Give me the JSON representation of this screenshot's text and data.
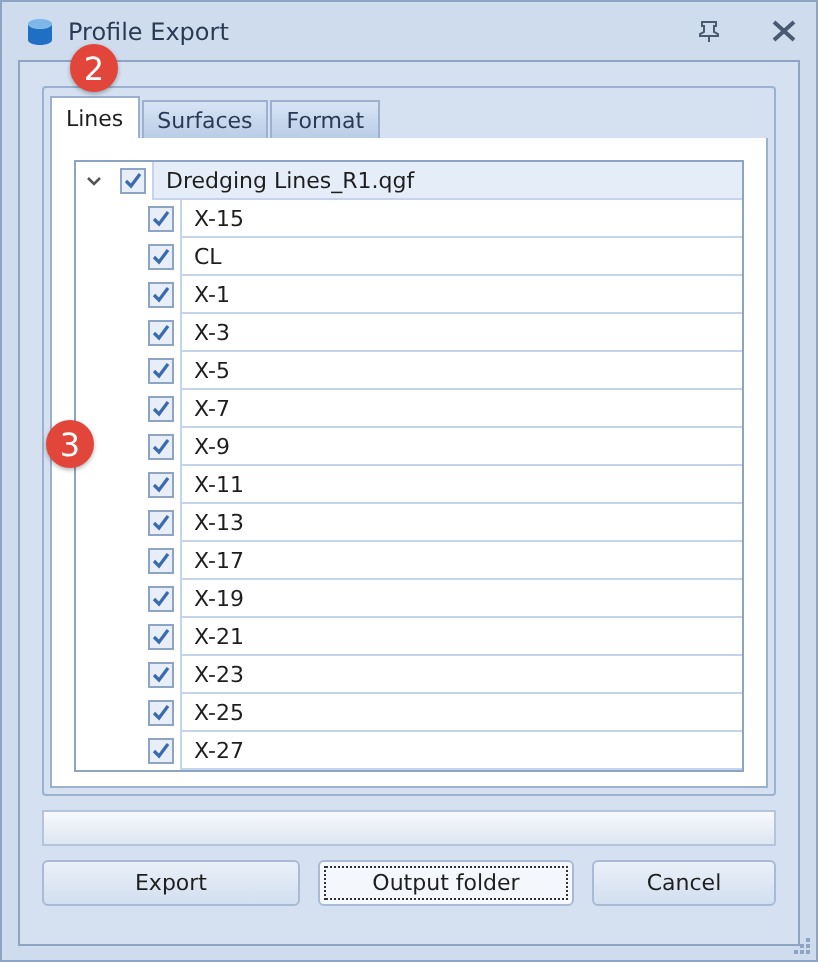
{
  "window": {
    "title": "Profile Export"
  },
  "badges": [
    {
      "label": "2"
    },
    {
      "label": "3"
    }
  ],
  "tabs": [
    {
      "label": "Lines",
      "selected": true
    },
    {
      "label": "Surfaces",
      "selected": false
    },
    {
      "label": "Format",
      "selected": false
    }
  ],
  "tree": {
    "label": "Dredging Lines_R1.qgf",
    "checked": true,
    "expanded": true,
    "selected": true,
    "children": [
      {
        "label": "X-15",
        "checked": true,
        "selected": false
      },
      {
        "label": "CL",
        "checked": true,
        "selected": false
      },
      {
        "label": "X-1",
        "checked": true,
        "selected": false
      },
      {
        "label": "X-3",
        "checked": true,
        "selected": false
      },
      {
        "label": "X-5",
        "checked": true,
        "selected": false
      },
      {
        "label": "X-7",
        "checked": true,
        "selected": false
      },
      {
        "label": "X-9",
        "checked": true,
        "selected": false
      },
      {
        "label": "X-11",
        "checked": true,
        "selected": false
      },
      {
        "label": "X-13",
        "checked": true,
        "selected": false
      },
      {
        "label": "X-17",
        "checked": true,
        "selected": false
      },
      {
        "label": "X-19",
        "checked": true,
        "selected": false
      },
      {
        "label": "X-21",
        "checked": true,
        "selected": false
      },
      {
        "label": "X-23",
        "checked": true,
        "selected": false
      },
      {
        "label": "X-25",
        "checked": true,
        "selected": false
      },
      {
        "label": "X-27",
        "checked": true,
        "selected": false
      }
    ]
  },
  "progress": {
    "level": 0
  },
  "buttons": [
    {
      "label": "Export",
      "focused": false
    },
    {
      "label": "Output folder",
      "focused": true
    },
    {
      "label": "Cancel",
      "focused": false
    }
  ]
}
